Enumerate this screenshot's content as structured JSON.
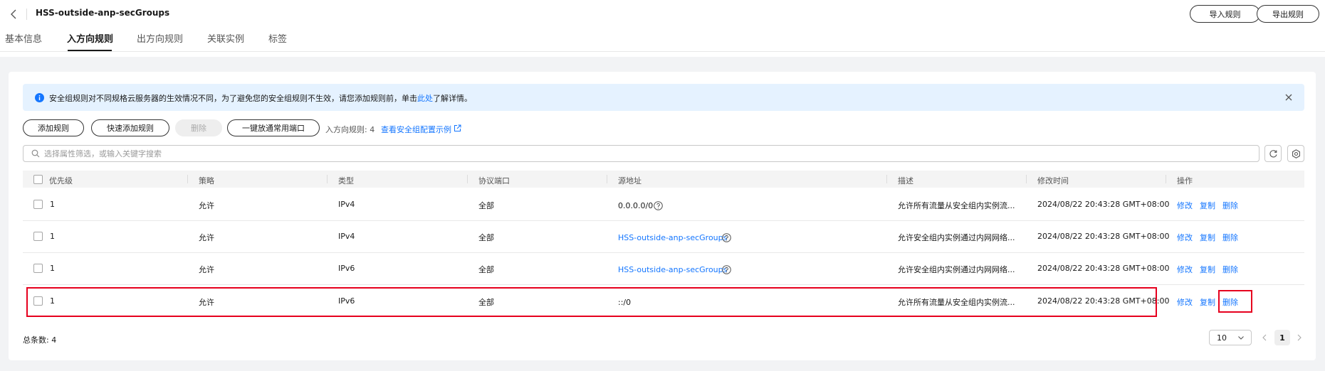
{
  "header": {
    "title": "HSS-outside-anp-secGroups",
    "import_label": "导入规则",
    "export_label": "导出规则"
  },
  "tabs": [
    {
      "label": "基本信息"
    },
    {
      "label": "入方向规则",
      "active": true
    },
    {
      "label": "出方向规则"
    },
    {
      "label": "关联实例"
    },
    {
      "label": "标签"
    }
  ],
  "alert": {
    "text_before": "安全组规则对不同规格云服务器的生效情况不同，为了避免您的安全组规则不生效，请您添加规则前，单击",
    "link": "此处",
    "text_after": "了解详情。"
  },
  "toolbar": {
    "add_rule": "添加规则",
    "quick_add": "快速添加规则",
    "delete": "删除",
    "open_common_ports": "一键放通常用端口",
    "rule_count": "入方向规则: 4",
    "example_link": "查看安全组配置示例"
  },
  "search": {
    "placeholder": "选择属性筛选，或输入关键字搜索"
  },
  "table": {
    "columns": [
      "优先级",
      "策略",
      "类型",
      "协议端口",
      "源地址",
      "描述",
      "修改时间",
      "操作"
    ],
    "rows": [
      {
        "priority": "1",
        "policy": "允许",
        "type": "IPv4",
        "port": "全部",
        "source": "0.0.0.0/0",
        "source_is_link": false,
        "source_help": true,
        "description": "允许所有流量从安全组内实例流...",
        "modified": "2024/08/22 20:43:28 GMT+08:00"
      },
      {
        "priority": "1",
        "policy": "允许",
        "type": "IPv4",
        "port": "全部",
        "source": "HSS-outside-anp-secGroups",
        "source_is_link": true,
        "source_help": true,
        "description": "允许安全组内实例通过内网网络...",
        "modified": "2024/08/22 20:43:28 GMT+08:00"
      },
      {
        "priority": "1",
        "policy": "允许",
        "type": "IPv6",
        "port": "全部",
        "source": "HSS-outside-anp-secGroups",
        "source_is_link": true,
        "source_help": true,
        "description": "允许安全组内实例通过内网网络...",
        "modified": "2024/08/22 20:43:28 GMT+08:00"
      },
      {
        "priority": "1",
        "policy": "允许",
        "type": "IPv6",
        "port": "全部",
        "source": "::/0",
        "source_is_link": false,
        "source_help": false,
        "description": "允许所有流量从安全组内实例流...",
        "modified": "2024/08/22 20:43:28 GMT+08:00"
      }
    ],
    "actions": {
      "modify": "修改",
      "copy": "复制",
      "delete": "删除"
    }
  },
  "footer": {
    "total": "总条数: 4",
    "page_size": "10",
    "current_page": "1"
  },
  "colors": {
    "link": "#1476ff",
    "alert_bg": "#e5f2ff",
    "highlight": "#e6001e"
  }
}
